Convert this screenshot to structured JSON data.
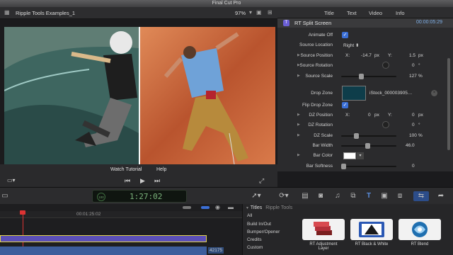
{
  "app": {
    "title": "Final Cut Pro"
  },
  "viewer": {
    "title": "Ripple Tools Examples_1",
    "zoom": "97%",
    "watch_tutorial": "Watch Tutorial",
    "help": "Help"
  },
  "inspector": {
    "tabs": [
      "Title",
      "Text",
      "Video",
      "Info"
    ],
    "effect_name": "RT Split Screen",
    "timecode": "00:00:05:29",
    "rows": {
      "animate_off": "Animate Off",
      "source_location": "Source Location",
      "source_location_value": "Right",
      "source_position": "Source Position",
      "source_position_x": "-14.7",
      "source_position_y": "1.5",
      "source_rotation": "Source Rotation",
      "source_rotation_value": "0",
      "source_scale": "Source Scale",
      "source_scale_value": "127",
      "drop_zone": "Drop Zone",
      "drop_zone_value": "iStock_000003905…",
      "flip_drop_zone": "Flip Drop Zone",
      "dz_position": "DZ Position",
      "dz_position_x": "0",
      "dz_position_y": "0",
      "dz_rotation": "DZ Rotation",
      "dz_rotation_value": "0",
      "dz_scale": "DZ Scale",
      "dz_scale_value": "100",
      "bar_width": "Bar Width",
      "bar_width_value": "46.0",
      "bar_color": "Bar Color",
      "bar_softness": "Bar Softness",
      "bar_softness_value": "0"
    },
    "units": {
      "x": "X:",
      "y": "Y:",
      "px": "px",
      "deg": "°",
      "pct": "%"
    }
  },
  "toolbar": {
    "timecode": "1:27:02",
    "percent": "100"
  },
  "timeline": {
    "ruler_timecode": "00:01:25:02",
    "clip_number": "42175"
  },
  "browser": {
    "header": "Titles",
    "subheader": "Ripple Tools",
    "categories": [
      "All",
      "Build In/Out",
      "Bumper/Opener",
      "Credits",
      "Custom"
    ],
    "tiles": [
      {
        "label_1": "RT Adjustment",
        "label_2": "Layer"
      },
      {
        "label_1": "RT Black & White",
        "label_2": ""
      },
      {
        "label_1": "RT Blend",
        "label_2": ""
      }
    ]
  },
  "colors": {
    "accent": "#3b6fd6",
    "effect_badge": "#6b5fd6",
    "timecode": "#7fb0e8"
  }
}
